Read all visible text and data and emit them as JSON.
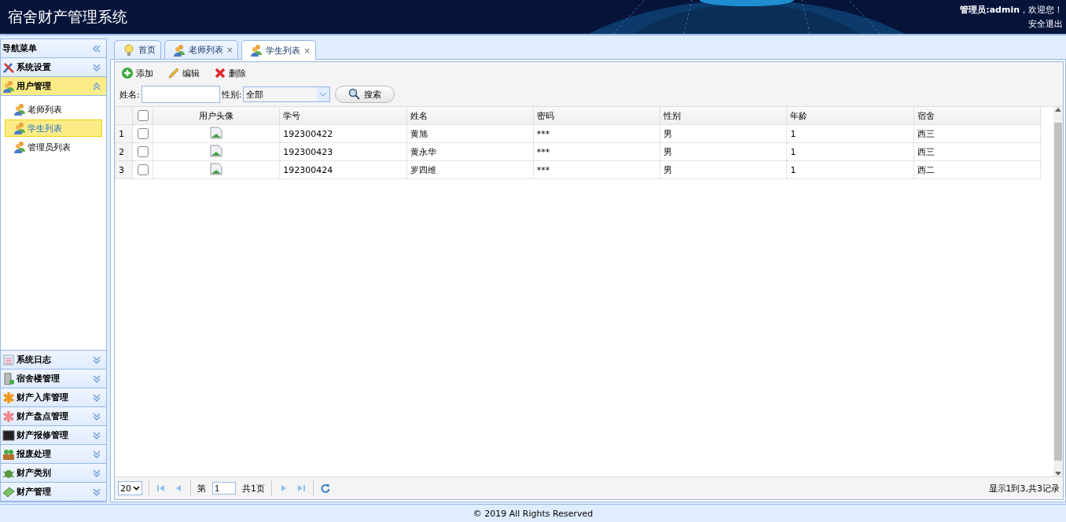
{
  "header": {
    "title": "宿舍财产管理系统",
    "greeting": "**管理员:admin**，欢迎您！",
    "logout": "安全退出"
  },
  "sidebar": {
    "title": "导航菜单",
    "sections": [
      {
        "label": "系统设置",
        "expanded": false
      },
      {
        "label": "用户管理",
        "expanded": true,
        "children": [
          {
            "label": "老师列表",
            "selected": false
          },
          {
            "label": "学生列表",
            "selected": true
          },
          {
            "label": "管理员列表",
            "selected": false
          }
        ]
      },
      {
        "label": "系统日志",
        "expanded": false
      },
      {
        "label": "宿舍楼管理",
        "expanded": false
      },
      {
        "label": "财产入库管理",
        "expanded": false
      },
      {
        "label": "财产盘点管理",
        "expanded": false
      },
      {
        "label": "财产报修管理",
        "expanded": false
      },
      {
        "label": "报废处理",
        "expanded": false
      },
      {
        "label": "财产类别",
        "expanded": false
      },
      {
        "label": "财产管理",
        "expanded": false
      }
    ]
  },
  "tabs": [
    {
      "label": "首页",
      "closable": false,
      "selected": false
    },
    {
      "label": "老师列表",
      "closable": true,
      "selected": false
    },
    {
      "label": "学生列表",
      "closable": true,
      "selected": true
    }
  ],
  "close_mark": "×",
  "toolbar": [
    {
      "label": "添加",
      "kind": "add"
    },
    {
      "label": "编辑",
      "kind": "edit"
    },
    {
      "label": "删除",
      "kind": "delete"
    }
  ],
  "search": {
    "name_label": "姓名:",
    "gender_label": "性别:",
    "gender_value": "全部",
    "button": "搜索"
  },
  "table": {
    "columns": [
      "用户头像",
      "学号",
      "姓名",
      "密码",
      "性别",
      "年龄",
      "宿舍"
    ],
    "header_checked": false,
    "rows": [
      {
        "index": "1",
        "checked": false,
        "cells": [
          "",
          "192300422",
          "黄旭",
          "***",
          "男",
          "1",
          "西三"
        ]
      },
      {
        "index": "2",
        "checked": false,
        "cells": [
          "",
          "192300423",
          "黄永华",
          "***",
          "男",
          "1",
          "西三"
        ]
      },
      {
        "index": "3",
        "checked": false,
        "cells": [
          "",
          "192300424",
          "罗四维",
          "***",
          "男",
          "1",
          "西二"
        ]
      }
    ]
  },
  "pager": {
    "page_size": "20",
    "page_prefix": "第",
    "page": "1",
    "page_total": "共1页",
    "info": "显示1到3,共3记录"
  },
  "footer": "© 2019 All Rights Reserved"
}
